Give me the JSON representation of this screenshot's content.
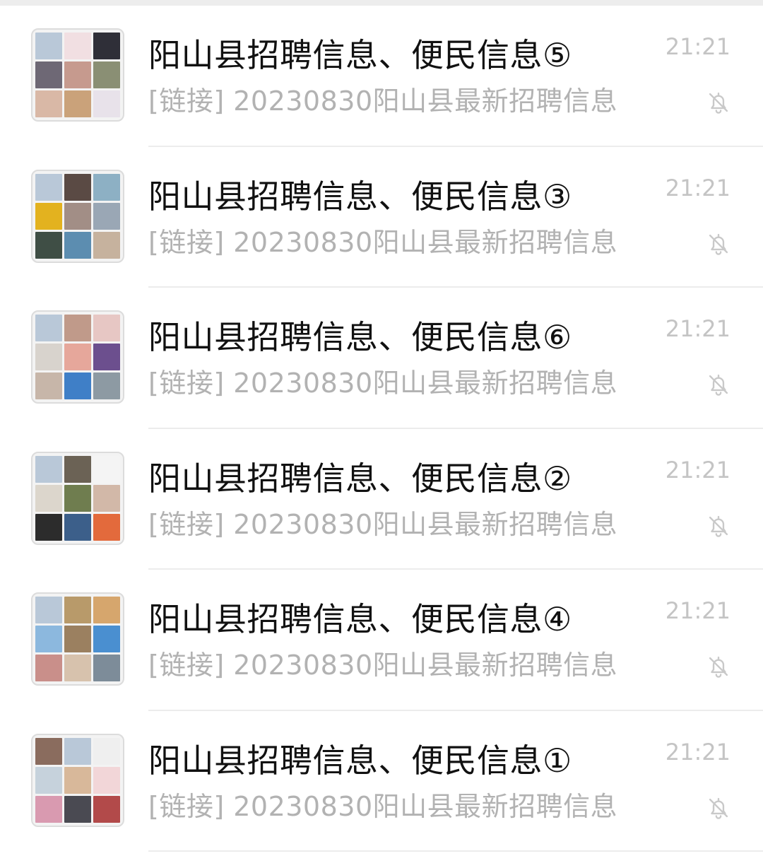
{
  "chats": [
    {
      "title": "阳山县招聘信息、便民信息⑤",
      "preview": "[链接] 20230830阳山县最新招聘信息",
      "time": "21:21",
      "muted_icon": "bell-off-icon",
      "avatar_tiles": [
        "#b9c8d8",
        "#f1dfe2",
        "#2f2f38",
        "#6e6875",
        "#c69a8e",
        "#8a8f74",
        "#d9b8a6",
        "#caa27a",
        "#e8e2ea"
      ]
    },
    {
      "title": "阳山县招聘信息、便民信息③",
      "preview": "[链接] 20230830阳山县最新招聘信息",
      "time": "21:21",
      "muted_icon": "bell-off-icon",
      "avatar_tiles": [
        "#b9c8d8",
        "#5a4a44",
        "#8db0c4",
        "#e3b21f",
        "#a28e86",
        "#9aa7b5",
        "#3f4e45",
        "#5c8db0",
        "#c6b29e"
      ]
    },
    {
      "title": "阳山县招聘信息、便民信息⑥",
      "preview": "[链接] 20230830阳山县最新招聘信息",
      "time": "21:21",
      "muted_icon": "bell-off-icon",
      "avatar_tiles": [
        "#b9c8d8",
        "#c09a8a",
        "#e7c7c4",
        "#d8d3cd",
        "#e6a79b",
        "#6c4f8e",
        "#c7b6a9",
        "#3f7fc7",
        "#8d9aa3"
      ]
    },
    {
      "title": "阳山县招聘信息、便民信息②",
      "preview": "[链接] 20230830阳山县最新招聘信息",
      "time": "21:21",
      "muted_icon": "bell-off-icon",
      "avatar_tiles": [
        "#b9c8d8",
        "#6b6255",
        "#f4f4f4",
        "#dcd6cc",
        "#6f7d4f",
        "#d2b8a8",
        "#2c2c2c",
        "#3c5f8a",
        "#e36a3c"
      ]
    },
    {
      "title": "阳山县招聘信息、便民信息④",
      "preview": "[链接] 20230830阳山县最新招聘信息",
      "time": "21:21",
      "muted_icon": "bell-off-icon",
      "avatar_tiles": [
        "#b9c8d8",
        "#b89a6a",
        "#d6a66d",
        "#8cb8de",
        "#9b8060",
        "#4a8fd0",
        "#c98f8a",
        "#d7c2ad",
        "#7d8c99"
      ]
    },
    {
      "title": "阳山县招聘信息、便民信息①",
      "preview": "[链接] 20230830阳山县最新招聘信息",
      "time": "21:21",
      "muted_icon": "bell-off-icon",
      "avatar_tiles": [
        "#8a6c5e",
        "#b9c8d8",
        "#efefef",
        "#c6d2dc",
        "#d8b89a",
        "#f2d6d8",
        "#d99ab0",
        "#4a4a52",
        "#b24a4a"
      ]
    }
  ]
}
